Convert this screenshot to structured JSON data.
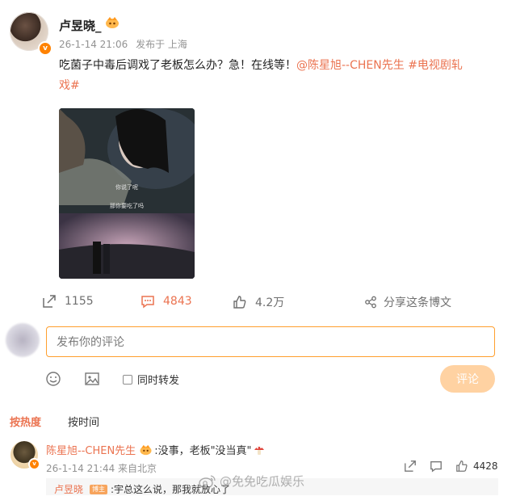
{
  "post": {
    "author": "卢昱晓_",
    "time": "26-1-14 21:06",
    "source": "发布于 上海",
    "text_plain": "吃菌子中毒后调戏了老板怎么办？急！在线等！",
    "mention": "@陈星旭--CHEN先生",
    "topic_line1": "#电视剧轧",
    "topic_line2": "戏#",
    "image_caption_top": "你说了呢",
    "image_caption_bottom": "那你要吃了吗"
  },
  "stats": {
    "repost": "1155",
    "comment": "4843",
    "like": "4.2万",
    "share": "分享这条博文"
  },
  "composer": {
    "placeholder": "发布你的评论",
    "repost_label": "同时转发",
    "submit": "评论"
  },
  "sort_tabs": {
    "hot": "按热度",
    "time": "按时间"
  },
  "comment": {
    "user": "陈星旭--CHEN先生",
    "text": ":没事，老板\"没当真\"",
    "time": "26-1-14 21:44 来自北京",
    "likes": "4428"
  },
  "reply": {
    "user": "卢昱晓",
    "badge": "博主",
    "text": ":宇总这么说，那我就放心了"
  },
  "watermark": "@免免吃瓜娱乐",
  "colors": {
    "accent": "#eb7350",
    "orange_border": "#ff9f2e",
    "button_disabled": "#ffd2a2"
  }
}
